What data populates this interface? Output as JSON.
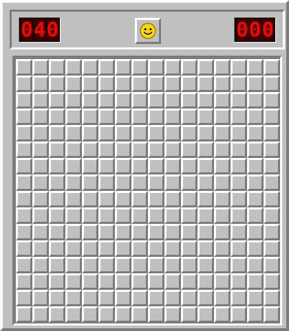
{
  "mine_counter": {
    "digits": [
      "0",
      "4",
      "0"
    ]
  },
  "timer": {
    "digits": [
      "0",
      "0",
      "0"
    ]
  },
  "face": {
    "icon": "smiley-face-icon",
    "state": "smile"
  },
  "board": {
    "rows": 16,
    "cols": 16,
    "cell_state": "unrevealed"
  },
  "colors": {
    "face": "#ffd700",
    "digit_on": "#ff0000",
    "digit_bg": "#3a0000",
    "panel": "#c0c0c0"
  }
}
